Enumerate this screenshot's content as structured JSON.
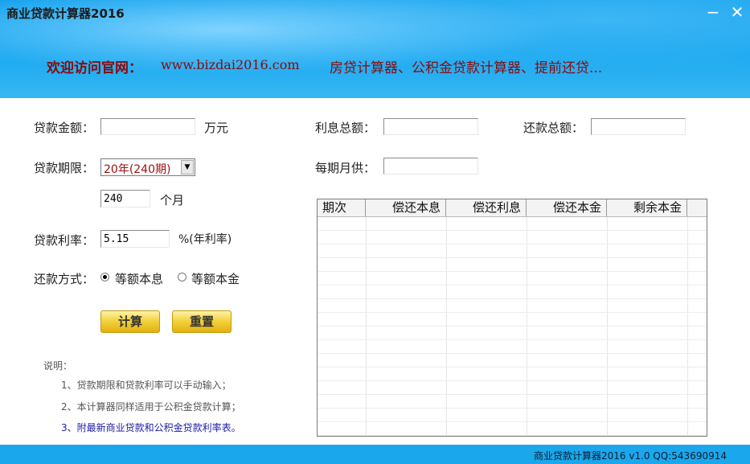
{
  "window": {
    "title": "商业贷款计算器2016",
    "minimize_symbol": "−",
    "close_symbol": "✕"
  },
  "banner": {
    "welcome": "欢迎访问官网：",
    "url": "www.bizdai2016.com",
    "promo": "房贷计算器、公积金贷款计算器、提前还贷..."
  },
  "form": {
    "loan_amount_label": "贷款金额：",
    "loan_amount_value": "",
    "loan_amount_unit": "万元",
    "term_label": "贷款期限：",
    "term_selected": "20年(240期)",
    "term_months_value": "240",
    "term_months_unit": "个月",
    "rate_label": "贷款利率：",
    "rate_value": "5.15",
    "rate_unit": "%(年利率)",
    "method_label": "还款方式：",
    "method_options": [
      {
        "label": "等额本息",
        "checked": true
      },
      {
        "label": "等额本金",
        "checked": false
      }
    ],
    "calc_button": "计算",
    "reset_button": "重置"
  },
  "results": {
    "total_interest_label": "利息总额：",
    "total_interest_value": "",
    "total_payment_label": "还款总额：",
    "total_payment_value": "",
    "monthly_label": "每期月供：",
    "monthly_value": ""
  },
  "table": {
    "columns": [
      "期次",
      "偿还本息",
      "偿还利息",
      "偿还本金",
      "剩余本金"
    ],
    "rows": []
  },
  "notes": {
    "heading": "说明：",
    "items": [
      "1、贷款期限和贷款利率可以手动输入；",
      "2、本计算器同样适用于公积金贷款计算；",
      "3、附最新商业贷款和公积金贷款利率表。"
    ]
  },
  "status": {
    "text": "商业贷款计算器2016 v1.0 QQ:543690914"
  },
  "colors": {
    "banner_blue": "#1aa8f0",
    "banner_text": "#8a0a0a",
    "button_gold": "#f2cf3a",
    "link_blue": "#1a1aa8"
  }
}
